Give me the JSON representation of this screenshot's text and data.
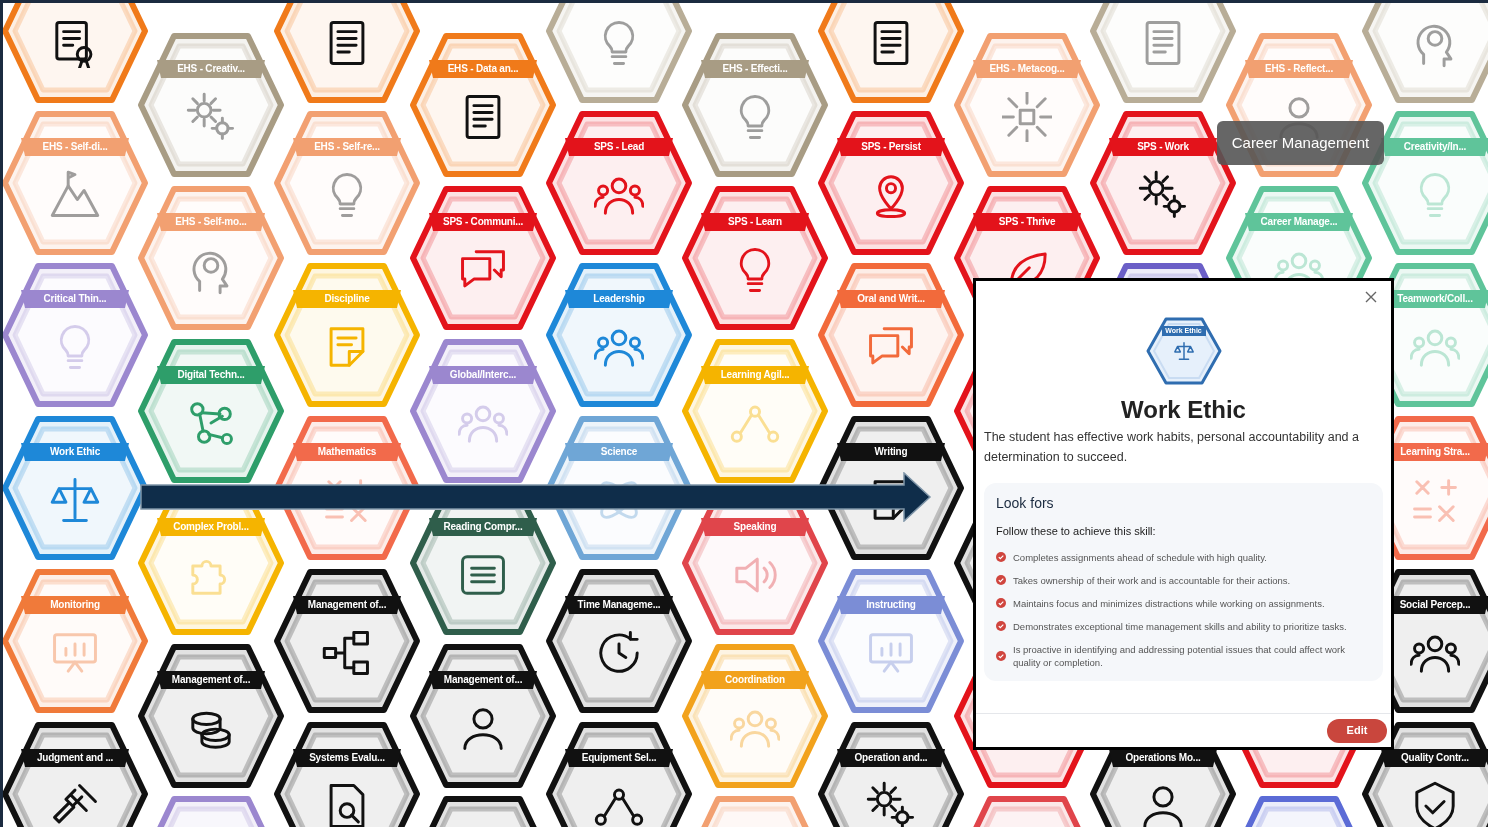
{
  "grid": {
    "columns": [
      {
        "tiles": [
          {
            "color": "#f07a1a",
            "faded": false
          },
          {
            "label": "EHS - Self-di...",
            "color": "#f2a071",
            "faded": true
          },
          {
            "label": "Critical Thin...",
            "color": "#9b87cf",
            "faded": true
          },
          {
            "label": "Work Ethic",
            "color": "#1e88d8",
            "faded": false
          },
          {
            "label": "Monitoring",
            "color": "#f07a3a",
            "faded": true
          },
          {
            "label": "Judgment and ...",
            "color": "#111111",
            "faded": false
          }
        ]
      },
      {
        "tiles": [
          {
            "label": "EHS - Creativ...",
            "color": "#a89c84",
            "faded": true
          },
          {
            "label": "EHS - Self-mo...",
            "color": "#f2a071",
            "faded": true
          },
          {
            "label": "Digital Techn...",
            "color": "#2e9e6a",
            "faded": false
          },
          {
            "label": "Complex Probl...",
            "color": "#f5b400",
            "faded": true
          },
          {
            "label": "Management of...",
            "color": "#111111",
            "faded": false
          },
          {
            "color": "#9b87cf"
          }
        ]
      },
      {
        "tiles": [
          {
            "color": "#f07a1a",
            "faded": false
          },
          {
            "label": "EHS - Self-re...",
            "color": "#f2a071",
            "faded": true
          },
          {
            "label": "Discipline",
            "color": "#f5b400",
            "faded": false
          },
          {
            "label": "Mathematics",
            "color": "#f26a4b",
            "faded": true
          },
          {
            "label": "Management of...",
            "color": "#111111",
            "faded": false
          },
          {
            "label": "Systems Evalu...",
            "color": "#111111",
            "faded": false
          }
        ]
      },
      {
        "tiles": [
          {
            "label": "EHS - Data an...",
            "color": "#f07a1a",
            "faded": false
          },
          {
            "label": "SPS - Communi...",
            "color": "#e3131b",
            "faded": false
          },
          {
            "label": "Global/Interc...",
            "color": "#9b87cf",
            "faded": true
          },
          {
            "label": "Reading Compr...",
            "color": "#2f5e4b",
            "faded": false
          },
          {
            "label": "Management of...",
            "color": "#111111",
            "faded": false
          },
          {
            "color": "#111111"
          }
        ]
      },
      {
        "tiles": [
          {
            "color": "#b8ad97",
            "faded": true
          },
          {
            "label": "SPS - Lead",
            "color": "#e3131b",
            "faded": false
          },
          {
            "label": "Leadership",
            "color": "#1e88d8",
            "faded": false
          },
          {
            "label": "Science",
            "color": "#6fa6d6",
            "faded": true
          },
          {
            "label": "Time Manageme...",
            "color": "#111111",
            "faded": false
          },
          {
            "label": "Equipment Sel...",
            "color": "#111111",
            "faded": false
          }
        ]
      },
      {
        "tiles": [
          {
            "label": "EHS - Effecti...",
            "color": "#a89c84",
            "faded": true
          },
          {
            "label": "SPS - Learn",
            "color": "#e3131b",
            "faded": false
          },
          {
            "label": "Learning Agil...",
            "color": "#f5b400",
            "faded": true
          },
          {
            "label": "Speaking",
            "color": "#e0454b",
            "faded": true
          },
          {
            "label": "Coordination",
            "color": "#f2a21c",
            "faded": true
          },
          {
            "color": "#f2a071"
          }
        ]
      },
      {
        "tiles": [
          {
            "color": "#f07a1a",
            "faded": false
          },
          {
            "label": "SPS - Persist",
            "color": "#e3131b",
            "faded": false
          },
          {
            "label": "Oral and Writ...",
            "color": "#f26a3b",
            "faded": false
          },
          {
            "label": "Writing",
            "color": "#111111",
            "faded": false
          },
          {
            "label": "Instructing",
            "color": "#7b8dd6",
            "faded": true
          },
          {
            "label": "Operation and...",
            "color": "#111111",
            "faded": false
          }
        ]
      },
      {
        "tiles": [
          {
            "label": "EHS - Metacog...",
            "color": "#f2a071",
            "faded": true
          },
          {
            "label": "SPS - Thrive",
            "color": "#e3131b",
            "faded": false
          },
          {
            "color": "#e3131b"
          },
          {
            "color": "#111111"
          },
          {
            "color": "#e3131b"
          },
          {
            "color": "#e0454b"
          }
        ]
      },
      {
        "tiles": [
          {
            "color": "#b8ad97",
            "faded": true
          },
          {
            "label": "SPS - Work",
            "color": "#e3131b",
            "faded": false
          },
          {
            "color": "#6b5fc7"
          },
          {
            "label": "Operations Mo...",
            "color": "#111111",
            "faded": false
          }
        ]
      },
      {
        "tiles": [
          {
            "label": "EHS - Reflect...",
            "color": "#f2a071",
            "faded": true
          },
          {
            "label": "Career Manage...",
            "color": "#5fc49a",
            "faded": true
          },
          {
            "color": "#e3131b"
          },
          {
            "color": "#5b6bd6"
          }
        ]
      },
      {
        "tiles": [
          {
            "color": "#b8ad97",
            "faded": true
          },
          {
            "label": "Creativity/In...",
            "color": "#5fc49a",
            "faded": true
          },
          {
            "label": "Teamwork/Coll...",
            "color": "#5fc49a",
            "faded": true
          },
          {
            "label": "Learning Stra...",
            "color": "#f26a4b",
            "faded": true
          },
          {
            "label": "Social Percep...",
            "color": "#111111",
            "faded": false
          },
          {
            "label": "Quality Contr...",
            "color": "#111111",
            "faded": false
          }
        ]
      }
    ]
  },
  "tooltip": {
    "text": "Career Management"
  },
  "dialog": {
    "badge_label": "Work Ethic",
    "title": "Work Ethic",
    "description": "The student has effective work habits, personal accountability and a determination to succeed.",
    "look_fors": {
      "title": "Look fors",
      "subtitle": "Follow these to achieve this skill:",
      "items": [
        "Completes assignments ahead of schedule with high quality.",
        "Takes ownership of their work and is accountable for their actions.",
        "Maintains focus and minimizes distractions while working on assignments.",
        "Demonstrates exceptional time management skills and ability to prioritize tasks.",
        "Is proactive in identifying and addressing potential issues that could affect work quality or completion."
      ]
    },
    "edit_button": "Edit"
  }
}
